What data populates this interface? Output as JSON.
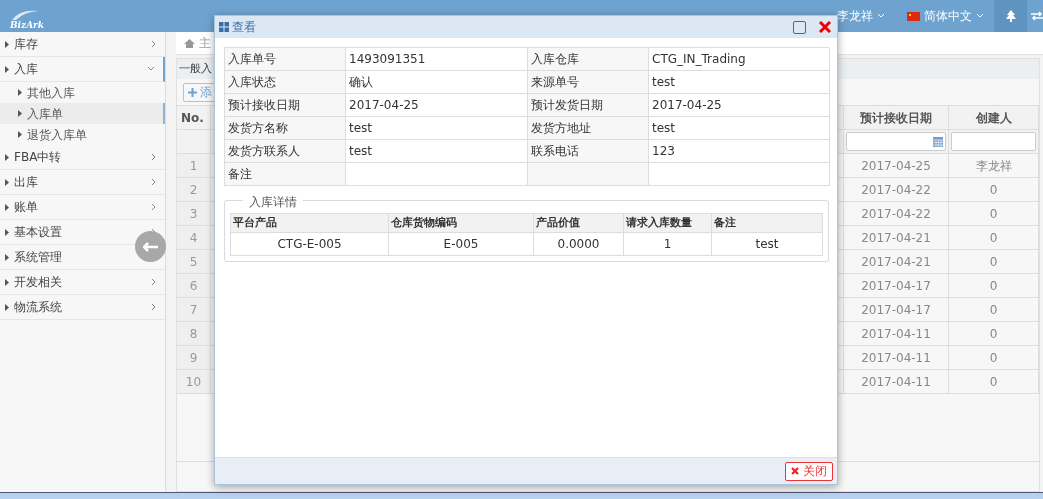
{
  "header": {
    "logo": "BizArk",
    "user": "李龙祥",
    "language": "简体中文"
  },
  "sidebar": {
    "items": [
      {
        "label": "库存",
        "expanded": false,
        "selected": false
      },
      {
        "label": "入库",
        "expanded": true,
        "selected": false,
        "children": [
          {
            "label": "其他入库",
            "selected": false
          },
          {
            "label": "入库单",
            "selected": true
          },
          {
            "label": "退货入库单",
            "selected": false
          }
        ]
      },
      {
        "label": "FBA中转",
        "expanded": false,
        "selected": false
      },
      {
        "label": "出库",
        "expanded": false,
        "selected": false
      },
      {
        "label": "账单",
        "expanded": false,
        "selected": false
      },
      {
        "label": "基本设置",
        "expanded": false,
        "selected": false
      },
      {
        "label": "系统管理",
        "expanded": false,
        "selected": false
      },
      {
        "label": "开发相关",
        "expanded": false,
        "selected": false
      },
      {
        "label": "物流系统",
        "expanded": false,
        "selected": false
      }
    ]
  },
  "background": {
    "breadcrumb": "主",
    "panel_title": "一般入",
    "add_button": "添",
    "table": {
      "columns": [
        "No.",
        "预计接收日期",
        "创建人"
      ],
      "rows": [
        {
          "no": "1",
          "date": "2017-04-25",
          "creator": "李龙祥"
        },
        {
          "no": "2",
          "date": "2017-04-22",
          "creator": "0"
        },
        {
          "no": "3",
          "date": "2017-04-22",
          "creator": "0"
        },
        {
          "no": "4",
          "date": "2017-04-21",
          "creator": "0"
        },
        {
          "no": "5",
          "date": "2017-04-21",
          "creator": "0"
        },
        {
          "no": "6",
          "date": "2017-04-17",
          "creator": "0"
        },
        {
          "no": "7",
          "date": "2017-04-17",
          "creator": "0"
        },
        {
          "no": "8",
          "date": "2017-04-11",
          "creator": "0"
        },
        {
          "no": "9",
          "date": "2017-04-11",
          "creator": "0"
        },
        {
          "no": "10",
          "date": "2017-04-11",
          "creator": "0"
        }
      ]
    }
  },
  "modal": {
    "title": "查看",
    "fields": [
      {
        "label": "入库单号",
        "value": "1493091351"
      },
      {
        "label": "入库仓库",
        "value": "CTG_IN_Trading"
      },
      {
        "label": "入库状态",
        "value": "确认"
      },
      {
        "label": "来源单号",
        "value": "test"
      },
      {
        "label": "预计接收日期",
        "value": "2017-04-25"
      },
      {
        "label": "预计发货日期",
        "value": "2017-04-25"
      },
      {
        "label": "发货方名称",
        "value": "test"
      },
      {
        "label": "发货方地址",
        "value": "test"
      },
      {
        "label": "发货方联系人",
        "value": "test"
      },
      {
        "label": "联系电话",
        "value": "123"
      },
      {
        "label": "备注"
      }
    ],
    "details": {
      "legend": "入库详情",
      "columns": [
        "平台产品",
        "仓库货物编码",
        "产品价值",
        "请求入库数量",
        "备注"
      ],
      "rows": [
        [
          "CTG-E-005",
          "E-005",
          "0.0000",
          "1",
          "test"
        ]
      ]
    },
    "close_button": "关闭"
  }
}
